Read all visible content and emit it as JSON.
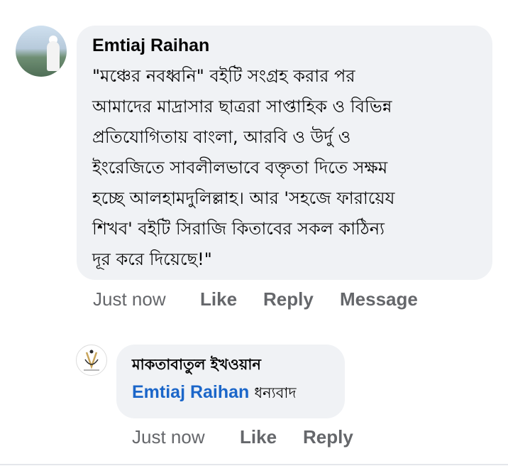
{
  "comment": {
    "author": "Emtiaj Raihan",
    "text_lines": [
      "\"মঞ্চের নবধ্বনি\" বইটি সংগ্রহ করার পর",
      "আমাদের মাদ্রাসার ছাত্ররা সাপ্তাহিক ও বিভিন্ন",
      "প্রতিযোগিতায় বাংলা, আরবি ও উর্দু ও",
      "ইংরেজিতে সাবলীলভাবে বক্তৃতা দিতে সক্ষম",
      "হচ্ছে আলহামদুলিল্লাহ। আর 'সহজে ফারায়েয",
      "শিখব' বইটি সিরাজি কিতাবের সকল কাঠিন্য",
      "দূর করে দিয়েছে!\""
    ],
    "actions": {
      "time": "Just now",
      "like": "Like",
      "reply": "Reply",
      "message": "Message"
    }
  },
  "reply": {
    "author": "মাকতাবাতুল ইখওয়ান",
    "mention": "Emtiaj Raihan",
    "text": "ধন্যবাদ",
    "actions": {
      "time": "Just now",
      "like": "Like",
      "reply": "Reply"
    }
  },
  "colors": {
    "bubble": "#f0f2f5",
    "mention": "#1b66c9",
    "meta": "#65676b"
  }
}
